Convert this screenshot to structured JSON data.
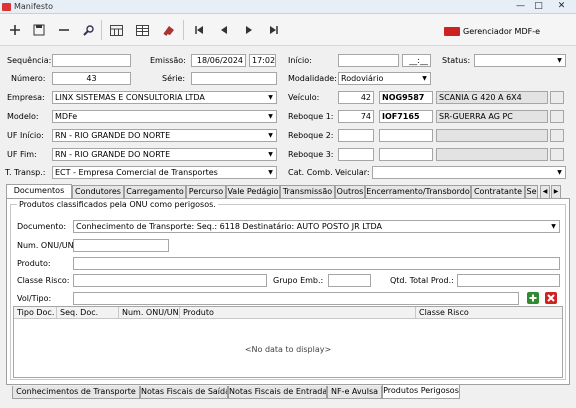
{
  "window": {
    "title": "Manifesto",
    "min": "—",
    "max": "□",
    "close": "✕"
  },
  "toolbar": {
    "gerenciador_label": "Gerenciador MDF-e"
  },
  "form": {
    "sequencia": {
      "label": "Sequência:",
      "value": ""
    },
    "emissao": {
      "label": "Emissão:",
      "date": "18/06/2024",
      "time": "17:02"
    },
    "inicio": {
      "label": "Início:",
      "date": "",
      "time": "__:__"
    },
    "status": {
      "label": "Status:",
      "value": ""
    },
    "numero": {
      "label": "Número:",
      "value": "43"
    },
    "serie": {
      "label": "Série:",
      "value": ""
    },
    "modalidade": {
      "label": "Modalidade:",
      "value": "Rodoviário"
    },
    "empresa": {
      "label": "Empresa:",
      "value": "LINX SISTEMAS E CONSULTORIA LTDA"
    },
    "veiculo": {
      "label": "Veículo:",
      "code": "42",
      "plate": "NOG9587",
      "desc": "SCANIA G 420 A 6X4"
    },
    "modelo": {
      "label": "Modelo:",
      "value": "MDFe"
    },
    "reboque1": {
      "label": "Reboque 1:",
      "code": "74",
      "plate": "IOF7165",
      "desc": "SR-GUERRA AG PC"
    },
    "uf_inicio": {
      "label": "UF Início:",
      "value": "RN - RIO GRANDE DO NORTE"
    },
    "reboque2": {
      "label": "Reboque 2:"
    },
    "uf_fim": {
      "label": "UF Fim:",
      "value": "RN - RIO GRANDE DO NORTE"
    },
    "reboque3": {
      "label": "Reboque 3:"
    },
    "t_transp": {
      "label": "T. Transp.:",
      "value": "ECT - Empresa Comercial de Transportes"
    },
    "cat_comb": {
      "label": "Cat. Comb. Veicular:",
      "value": ""
    }
  },
  "tabs": [
    "Documentos",
    "Condutores",
    "Carregamento",
    "Percurso",
    "Vale Pedágio",
    "Transmissão",
    "Outros",
    "Encerramento/Transbordo",
    "Contratante",
    "Se"
  ],
  "panel": {
    "group_label": "Produtos classificados pela ONU como perigosos.",
    "documento": {
      "label": "Documento:",
      "value": "Conhecimento de Transporte: Seq.: 6118 Destinatário: AUTO POSTO JR LTDA"
    },
    "num_onu": {
      "label": "Num. ONU/UN:"
    },
    "produto": {
      "label": "Produto:"
    },
    "classe_risco": {
      "label": "Classe Risco:"
    },
    "grupo_emb": {
      "label": "Grupo Emb.:"
    },
    "qtd_total": {
      "label": "Qtd. Total Prod.:"
    },
    "vol_tipo": {
      "label": "Vol/Tipo:"
    },
    "grid": {
      "columns": [
        "Tipo Doc.",
        "Seq. Doc.",
        "Num. ONU/UN",
        "Produto",
        "Classe Risco"
      ],
      "empty": "<No data to display>"
    }
  },
  "bottom_tabs": [
    "Conhecimentos de Transporte",
    "Notas Fiscais de Saída",
    "Notas Fiscais de Entrada",
    "NF-e Avulsa",
    "Produtos Perigosos"
  ],
  "colors": {
    "add_green": "#2e8b2e",
    "delete_red": "#d02020"
  }
}
